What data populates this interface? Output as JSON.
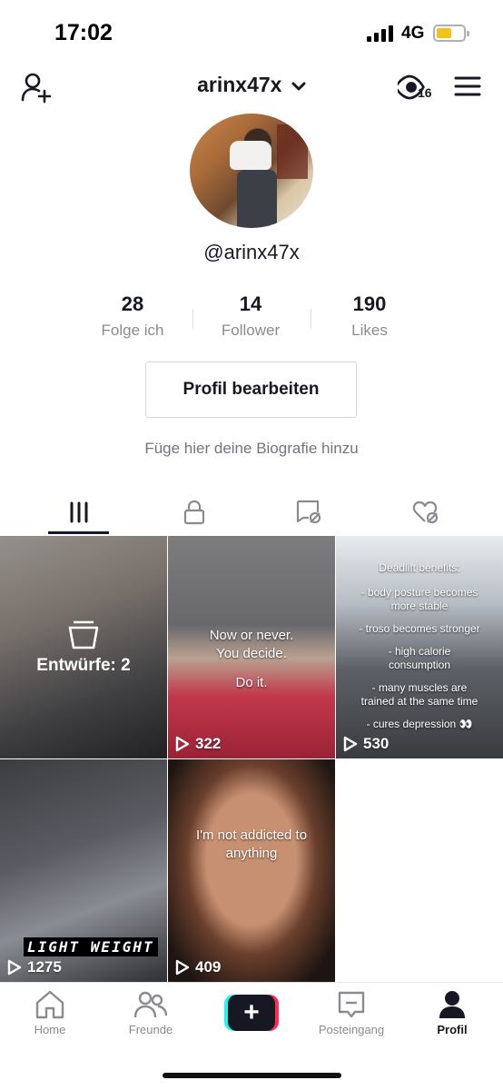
{
  "status_bar": {
    "time": "17:02",
    "network": "4G"
  },
  "header": {
    "username": "arinx47x",
    "viewers_count": "16"
  },
  "profile": {
    "handle": "@arinx47x",
    "stats": [
      {
        "value": "28",
        "label": "Folge ich"
      },
      {
        "value": "14",
        "label": "Follower"
      },
      {
        "value": "190",
        "label": "Likes"
      }
    ],
    "edit_button": "Profil bearbeiten",
    "bio_placeholder": "Füge hier deine Biografie hinzu"
  },
  "tabs": [
    {
      "icon": "videos-grid-icon",
      "active": true
    },
    {
      "icon": "lock-icon",
      "active": false
    },
    {
      "icon": "tagged-icon",
      "active": false
    },
    {
      "icon": "liked-hidden-icon",
      "active": false
    }
  ],
  "videos": {
    "drafts": {
      "label": "Entwürfe: 2"
    },
    "items": [
      {
        "caption_lines": [
          "Now or never.",
          "You decide.",
          "",
          "Do it."
        ],
        "views": "322"
      },
      {
        "caption_title": "Deadlift benefits:",
        "caption_lines": [
          "- body posture becomes",
          "more stable",
          "- troso becomes stronger",
          "- high calorie",
          "consumption",
          "- many muscles are",
          "trained at the same time",
          "- cures depression 👀"
        ],
        "views": "530"
      },
      {
        "overlay_text": "LIGHT WEIGHT",
        "views": "1275"
      },
      {
        "caption_lines": [
          "I'm not addicted to",
          "anything"
        ],
        "views": "409"
      }
    ]
  },
  "bottom_nav": [
    {
      "label": "Home",
      "icon": "home-icon",
      "active": false
    },
    {
      "label": "Freunde",
      "icon": "friends-icon",
      "active": false
    },
    {
      "label": "",
      "icon": "plus-icon",
      "active": false
    },
    {
      "label": "Posteingang",
      "icon": "inbox-icon",
      "active": false
    },
    {
      "label": "Profil",
      "icon": "profile-icon",
      "active": true
    }
  ],
  "colors": {
    "accent_cyan": "#25f4ee",
    "accent_red": "#fe2c55",
    "text": "#161823",
    "muted": "#8a8b91",
    "battery": "#f2c31a"
  }
}
